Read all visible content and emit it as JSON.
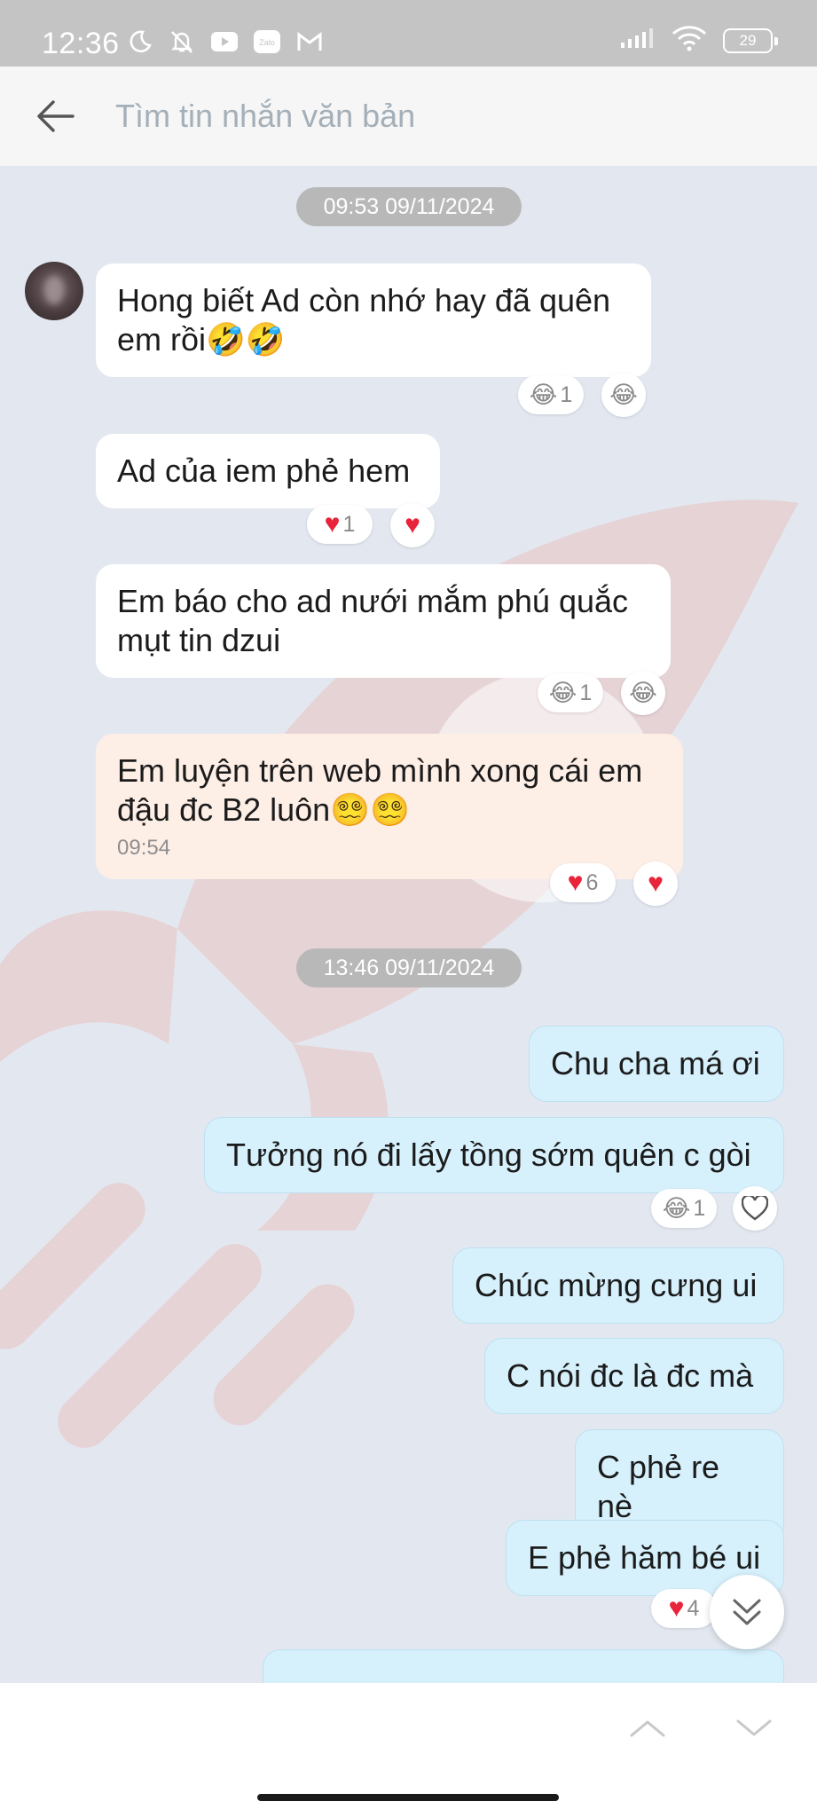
{
  "status_bar": {
    "time": "12:36",
    "battery": "29",
    "icons": [
      "moon-icon",
      "bell-off-icon",
      "youtube-icon",
      "zalo-icon",
      "gmail-icon",
      "signal-icon",
      "wifi-icon",
      "battery-icon"
    ],
    "zalo_label": "Zalo"
  },
  "search": {
    "placeholder": "Tìm tin nhắn văn bản"
  },
  "chat": {
    "date_pills": [
      "09:53 09/11/2024",
      "13:46 09/11/2024"
    ],
    "messages": [
      {
        "dir": "in",
        "text": "Hong biết Ad còn nhớ hay đã quên em rồi🤣🤣",
        "reaction_count": "1",
        "reaction": "😂"
      },
      {
        "dir": "in",
        "text": "Ad của iem phẻ hem",
        "reaction_count": "1",
        "reaction": "❤️"
      },
      {
        "dir": "in",
        "text": "Em báo cho ad nưới mắm phú quắc mụt tin dzui",
        "reaction_count": "1",
        "reaction": "😂"
      },
      {
        "dir": "in",
        "text": "Em luyện trên web mình xong cái em đậu đc B2 luôn😵‍💫😵‍💫",
        "time": "09:54",
        "reaction_count": "6",
        "reaction": "❤️"
      },
      {
        "dir": "out",
        "text": "Chu cha má ơi"
      },
      {
        "dir": "out",
        "text": "Tưởng nó đi lấy tồng sớm quên c gòi",
        "reaction_count": "1",
        "reaction": "😂"
      },
      {
        "dir": "out",
        "text": "Chúc mừng cưng ui"
      },
      {
        "dir": "out",
        "text": "C nói đc là đc mà"
      },
      {
        "dir": "out",
        "text": "C phẻ re nè"
      },
      {
        "dir": "out",
        "text": "E phẻ hăm bé ui",
        "reaction_count": "4",
        "reaction": "❤️"
      }
    ]
  },
  "colors": {
    "accent": "#e8233a",
    "outgoing_bubble": "#d6f0fc",
    "chat_bg": "#e3e8f0"
  }
}
